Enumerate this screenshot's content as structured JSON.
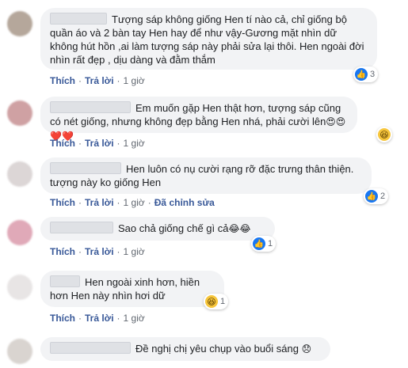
{
  "comments": [
    {
      "text": "Tượng sáp không giống Hen tí nào cả, chỉ giống bộ quần áo và 2 bàn tay Hen hay để như vậy-Gương mặt nhìn dữ không hút hồn ,ai làm tượng sáp này phải sửa lại thôi. Hen ngoài đời nhìn rất đẹp , dịu dàng và đằm thắm",
      "like": "Thích",
      "reply": "Trả lời",
      "time": "1 giờ",
      "reaction_count": "3",
      "reaction_icon": "like-icon",
      "edited": ""
    },
    {
      "text": "Em muốn gặp Hen thật hơn, tượng sáp cũng có nét giống, nhưng không đẹp bằng Hen nhá, phải cười lên",
      "emoji": "😍😍❤️❤️",
      "like": "Thích",
      "reply": "Trả lời",
      "time": "1 giờ",
      "reaction_count": "",
      "reaction_icon": "haha-icon",
      "edited": ""
    },
    {
      "text": "Hen luôn có nụ cười rạng rỡ đặc trưng thân thiện. tượng này ko giống Hen",
      "like": "Thích",
      "reply": "Trả lời",
      "time": "1 giờ",
      "reaction_count": "2",
      "reaction_icon": "like-icon",
      "edited": "Đã chỉnh sửa"
    },
    {
      "text": "Sao chả giống chế gì cả",
      "emoji": "😂😂",
      "like": "Thích",
      "reply": "Trả lời",
      "time": "1 giờ",
      "reaction_count": "1",
      "reaction_icon": "like-icon",
      "edited": ""
    },
    {
      "text": "Hen ngoài xinh hơn, hiền hơn Hen này nhìn hơi dữ",
      "like": "Thích",
      "reply": "Trả lời",
      "time": "1 giờ",
      "reaction_count": "1",
      "reaction_icon": "haha-icon",
      "edited": ""
    },
    {
      "text": "Đề nghị chị yêu chụp vào buổi sáng",
      "emoji": "😞",
      "like": "",
      "reply": "",
      "time": "",
      "reaction_count": "",
      "reaction_icon": "",
      "edited": ""
    }
  ],
  "colors": {
    "bubble": "#f2f3f5",
    "link": "#385898",
    "like_blue": "#1877f2",
    "haha_yellow": "#f7c63c"
  }
}
